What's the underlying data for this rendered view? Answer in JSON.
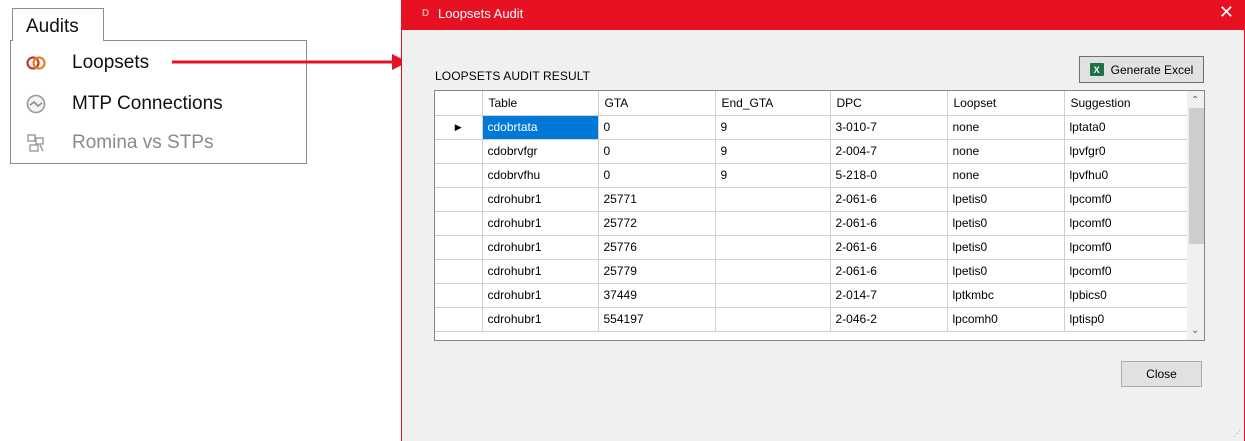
{
  "menu": {
    "tab_label": "Audits",
    "items": [
      {
        "label": "Loopsets",
        "icon": "loopset-rings-icon",
        "enabled": true
      },
      {
        "label": "MTP Connections",
        "icon": "mtp-connection-icon",
        "enabled": true
      },
      {
        "label": "Romina vs STPs",
        "icon": "romina-stp-icon",
        "enabled": false
      }
    ]
  },
  "arrow_color": "#e81123",
  "dialog": {
    "title": "Loopsets Audit",
    "titlebar_color": "#e81123",
    "close_glyph": "✕",
    "section_label": "LOOPSETS AUDIT RESULT",
    "generate_excel_label": "Generate Excel",
    "close_label": "Close",
    "grid": {
      "columns": [
        "Table",
        "GTA",
        "End_GTA",
        "DPC",
        "Loopset",
        "Suggestion"
      ],
      "rows": [
        [
          "cdobrtata",
          "0",
          "9",
          "3-010-7",
          "none",
          "lptata0"
        ],
        [
          "cdobrvfgr",
          "0",
          "9",
          "2-004-7",
          "none",
          "lpvfgr0"
        ],
        [
          "cdobrvfhu",
          "0",
          "9",
          "5-218-0",
          "none",
          "lpvfhu0"
        ],
        [
          "cdrohubr1",
          "25771",
          "",
          "2-061-6",
          "lpetis0",
          "lpcomf0"
        ],
        [
          "cdrohubr1",
          "25772",
          "",
          "2-061-6",
          "lpetis0",
          "lpcomf0"
        ],
        [
          "cdrohubr1",
          "25776",
          "",
          "2-061-6",
          "lpetis0",
          "lpcomf0"
        ],
        [
          "cdrohubr1",
          "25779",
          "",
          "2-061-6",
          "lpetis0",
          "lpcomf0"
        ],
        [
          "cdrohubr1",
          "37449",
          "",
          "2-014-7",
          "lptkmbc",
          "lpbics0"
        ],
        [
          "cdrohubr1",
          "554197",
          "",
          "2-046-2",
          "lpcomh0",
          "lptisp0"
        ]
      ],
      "selected_row": 0,
      "selected_color": "#0078d7"
    }
  }
}
